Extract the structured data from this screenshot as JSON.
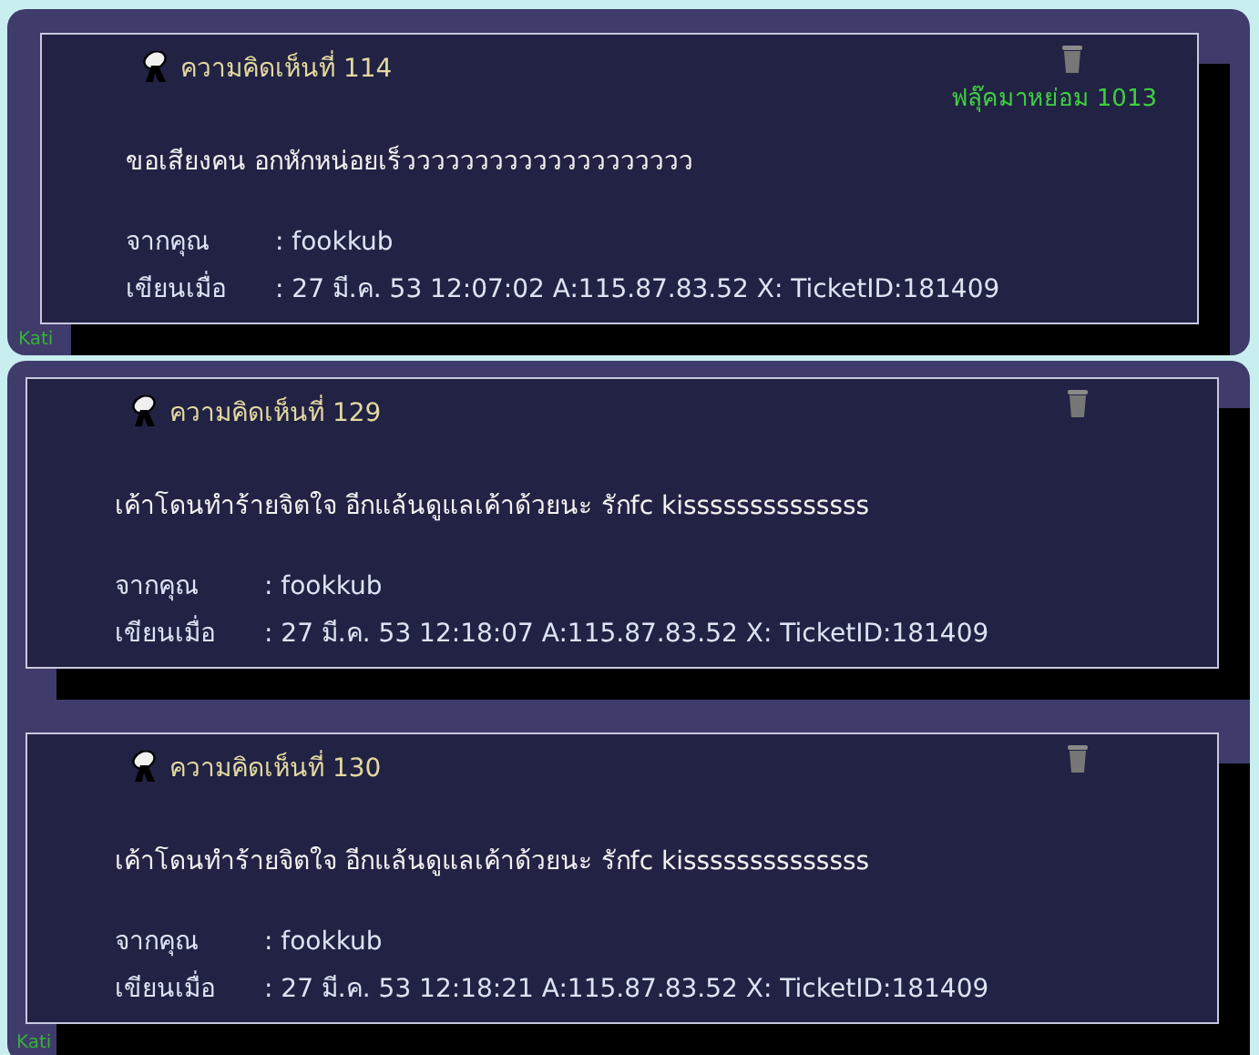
{
  "panels": [
    {
      "comments": [
        {
          "title": "ความคิดเห็นที่ 114",
          "badge": "ฟลุ๊คมาหย่อม 1013",
          "message": "ขอเสียงคน อกหักหน่อยเร็วววววววววววววววววววว",
          "from_label": "จากคุณ",
          "from": ": fookkub",
          "date_label": "เขียนเมื่อ",
          "date": ": 27 มี.ค. 53 12:07:02 A:115.87.83.52 X: TicketID:181409"
        }
      ],
      "footer": "Kati"
    },
    {
      "comments": [
        {
          "title": "ความคิดเห็นที่ 129",
          "message": "เค้าโดนทำร้ายจิตใจ อีกแล้นดูแลเค้าด้วยนะ รักfc kissssssssssssss",
          "from_label": "จากคุณ",
          "from": ": fookkub",
          "date_label": "เขียนเมื่อ",
          "date": ": 27 มี.ค. 53 12:18:07 A:115.87.83.52 X: TicketID:181409"
        },
        {
          "title": "ความคิดเห็นที่ 130",
          "message": "เค้าโดนทำร้ายจิตใจ อีกแล้นดูแลเค้าด้วยนะ รักfc kissssssssssssss",
          "from_label": "จากคุณ",
          "from": ": fookkub",
          "date_label": "เขียนเมื่อ",
          "date": ": 27 มี.ค. 53 12:18:21 A:115.87.83.52 X: TicketID:181409"
        }
      ],
      "footer": "Kati"
    }
  ]
}
